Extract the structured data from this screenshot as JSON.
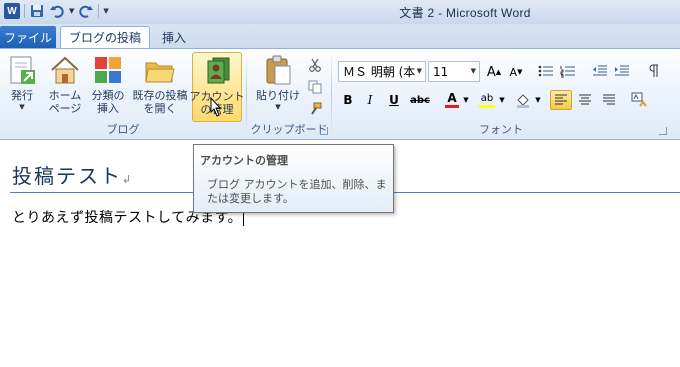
{
  "window": {
    "title": "文書 2 - Microsoft Word"
  },
  "quick_access": {
    "icons": [
      "word-logo",
      "save-icon",
      "undo-icon",
      "redo-icon",
      "customize-dropdown-icon"
    ],
    "logo_letter": "W"
  },
  "tabs": [
    {
      "label": "ファイル",
      "active": false
    },
    {
      "label": "ブログの投稿",
      "active": true
    },
    {
      "label": "挿入",
      "active": false
    }
  ],
  "ribbon": {
    "blog_group": {
      "label": "ブログ",
      "buttons": [
        {
          "line1": "発行",
          "line2": "",
          "icon": "publish-icon"
        },
        {
          "line1": "ホーム",
          "line2": "ページ",
          "icon": "home-page-icon"
        },
        {
          "line1": "分類の",
          "line2": "挿入",
          "icon": "insert-category-icon"
        },
        {
          "line1": "既存の投稿",
          "line2": "を開く",
          "icon": "open-existing-icon"
        },
        {
          "line1": "アカウント",
          "line2": "の管理",
          "icon": "manage-accounts-icon"
        }
      ]
    },
    "clipboard_group": {
      "label": "クリップボード",
      "paste_label": "貼り付け",
      "small_icons": [
        "cut-icon",
        "copy-icon",
        "format-painter-icon"
      ]
    },
    "font_group": {
      "label": "フォント",
      "font_name": "ＭＳ 明朝 (本",
      "font_size": "11",
      "bold": "B",
      "italic": "I",
      "underline": "U",
      "strike": "abc",
      "font_color_letter": "A",
      "highlight_letter": "ab",
      "accent_red": "#e02020",
      "highlight_yellow": "#ffff00"
    }
  },
  "document": {
    "heading": "投稿テスト",
    "heading_mark": "↲",
    "body": "とりあえず投稿テストしてみます。"
  },
  "tooltip": {
    "title": "アカウントの管理",
    "body": "ブログ アカウントを追加、削除、または変更します。"
  }
}
